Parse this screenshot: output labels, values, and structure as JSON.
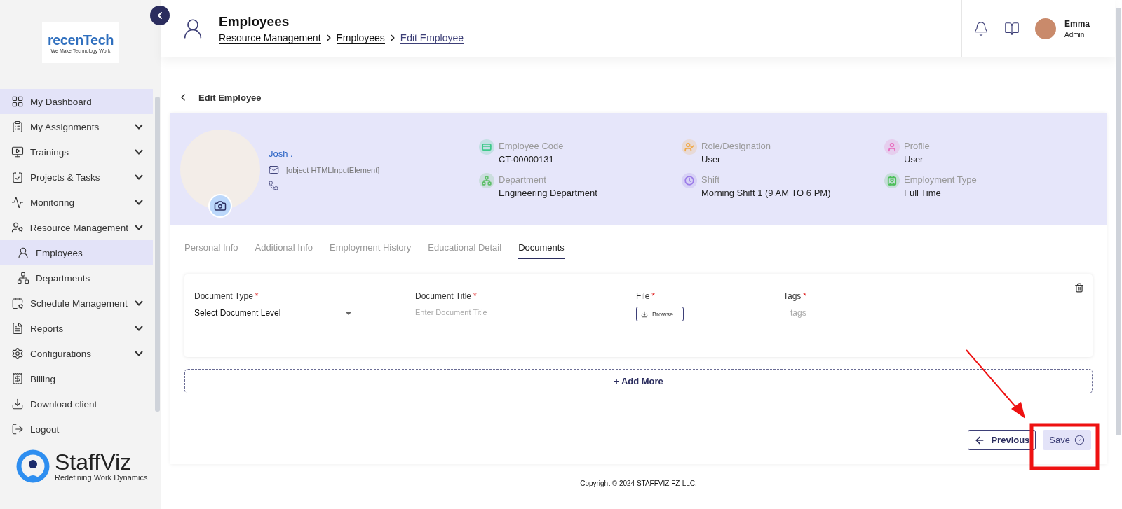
{
  "sidebar": {
    "logo": {
      "name": "recenTech",
      "tagline": "We Make Technology Work"
    },
    "items": [
      {
        "label": "My Dashboard",
        "kind": "link",
        "selected": true
      },
      {
        "label": "My Assignments",
        "kind": "group",
        "selected": false
      },
      {
        "label": "Trainings",
        "kind": "group",
        "selected": false
      },
      {
        "label": "Projects & Tasks",
        "kind": "group",
        "selected": false
      },
      {
        "label": "Monitoring",
        "kind": "group",
        "selected": false
      },
      {
        "label": "Resource Management",
        "kind": "group",
        "selected": false,
        "children": [
          {
            "label": "Employees",
            "selected": true
          },
          {
            "label": "Departments",
            "selected": false
          }
        ]
      },
      {
        "label": "Schedule Management",
        "kind": "group",
        "selected": false
      },
      {
        "label": "Reports",
        "kind": "group",
        "selected": false
      },
      {
        "label": "Configurations",
        "kind": "group",
        "selected": false
      },
      {
        "label": "Billing",
        "kind": "link",
        "selected": false
      },
      {
        "label": "Download client",
        "kind": "link",
        "selected": false
      },
      {
        "label": "Logout",
        "kind": "link",
        "selected": false
      }
    ],
    "brand": {
      "name": "StaffViz",
      "tagline": "Redefining Work Dynamics"
    }
  },
  "header": {
    "title": "Employees",
    "breadcrumbs": [
      {
        "label": "Resource Management",
        "selected": false
      },
      {
        "label": "Employees",
        "selected": false
      },
      {
        "label": "Edit Employee",
        "selected": true
      }
    ],
    "user": {
      "name": "Emma",
      "role": "Admin"
    }
  },
  "page": {
    "title": "Edit Employee"
  },
  "profile": {
    "name": "Josh .",
    "email": "[object HTMLInputElement]",
    "fields": [
      {
        "label": "Employee Code",
        "value": "CT-00000131",
        "color": "#3ec98a"
      },
      {
        "label": "Role/Designation",
        "value": "User",
        "color": "#f0a94a"
      },
      {
        "label": "Profile",
        "value": "User",
        "color": "#e86fc0"
      },
      {
        "label": "Department",
        "value": "Engineering Department",
        "color": "#5fbf6a"
      },
      {
        "label": "Shift",
        "value": "Morning Shift 1 (9 AM TO 6 PM)",
        "color": "#9b7ce8"
      },
      {
        "label": "Employment Type",
        "value": "Full Time",
        "color": "#4cbf5a"
      }
    ]
  },
  "tabs": [
    {
      "label": "Personal Info",
      "selected": false
    },
    {
      "label": "Additional Info",
      "selected": false
    },
    {
      "label": "Employment History",
      "selected": false
    },
    {
      "label": "Educational Detail",
      "selected": false
    },
    {
      "label": "Documents",
      "selected": true
    }
  ],
  "document": {
    "fields": [
      {
        "kind": "select",
        "label": "Document Type",
        "mark": "*",
        "value": "Select Document Level"
      },
      {
        "kind": "text",
        "label": "Document Title",
        "mark": "*",
        "placeholder": "Enter Document Title"
      },
      {
        "kind": "file",
        "label": "File",
        "mark": "*",
        "button": "Browse"
      },
      {
        "kind": "tags",
        "label": "Tags",
        "mark": "*",
        "placeholder": "tags"
      }
    ]
  },
  "add_more": "+ Add More",
  "buttons": {
    "previous": "Previous",
    "save": "Save"
  },
  "footer": "Copyright © 2024 STAFFVIZ FZ-LLC."
}
